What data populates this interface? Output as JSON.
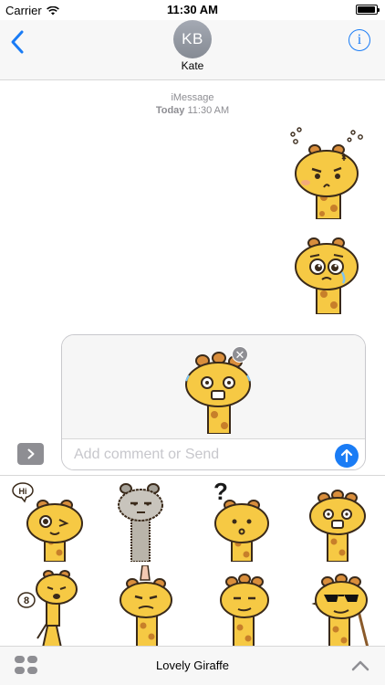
{
  "status_bar": {
    "carrier": "Carrier",
    "time": "11:30 AM"
  },
  "header": {
    "avatar_initials": "KB",
    "contact_name": "Kate"
  },
  "conversation": {
    "service": "iMessage",
    "day": "Today",
    "time": "11:30 AM"
  },
  "composer": {
    "placeholder": "Add comment or Send"
  },
  "drawer": {
    "stickers": [
      {
        "name": "wink-hi",
        "bubble": "Hi"
      },
      {
        "name": "ostrich-stare",
        "bubble": ""
      },
      {
        "name": "question",
        "bubble": "?"
      },
      {
        "name": "shock",
        "bubble": ""
      },
      {
        "name": "crying-8",
        "bubble": "8"
      },
      {
        "name": "poked-annoyed",
        "bubble": ""
      },
      {
        "name": "smug",
        "bubble": ""
      },
      {
        "name": "sunglasses",
        "bubble": ""
      }
    ]
  },
  "bottom_bar": {
    "pack_name": "Lovely Giraffe"
  },
  "colors": {
    "accent": "#1a7cf5",
    "giraffe_yellow": "#f6c944",
    "giraffe_spots": "#c77f2a",
    "outline": "#3a2a1a"
  }
}
